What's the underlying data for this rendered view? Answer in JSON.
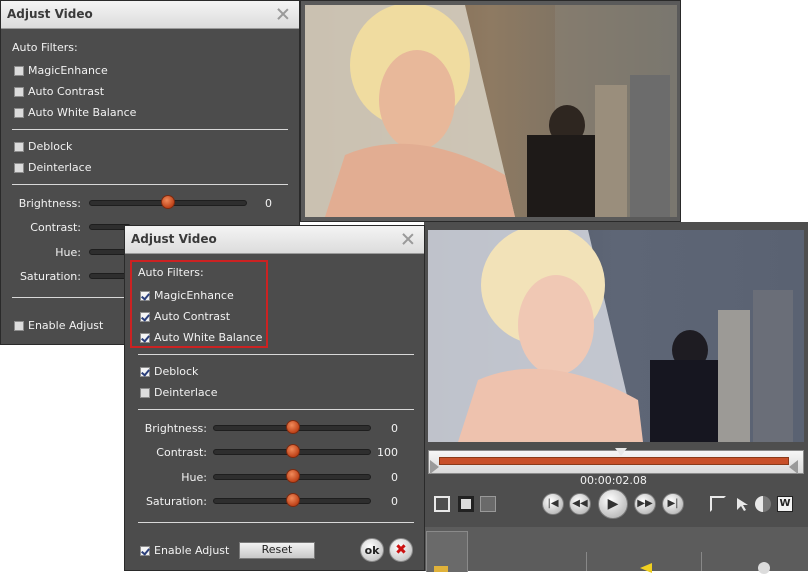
{
  "back_dialog": {
    "title": "Adjust Video",
    "auto_filters_label": "Auto Filters:",
    "filters": [
      {
        "label": "MagicEnhance",
        "checked": false
      },
      {
        "label": "Auto Contrast",
        "checked": false
      },
      {
        "label": "Auto White Balance",
        "checked": false
      }
    ],
    "deblock": {
      "label": "Deblock",
      "checked": false
    },
    "deinterlace": {
      "label": "Deinterlace",
      "checked": false
    },
    "sliders": [
      {
        "label": "Brightness:",
        "value": "0"
      },
      {
        "label": "Contrast:",
        "value": ""
      },
      {
        "label": "Hue:",
        "value": ""
      },
      {
        "label": "Saturation:",
        "value": ""
      }
    ],
    "enable_adjust": {
      "label": "Enable Adjust",
      "checked": false
    }
  },
  "front_dialog": {
    "title": "Adjust Video",
    "auto_filters_label": "Auto Filters:",
    "filters": [
      {
        "label": "MagicEnhance",
        "checked": true
      },
      {
        "label": "Auto Contrast",
        "checked": true
      },
      {
        "label": "Auto White Balance",
        "checked": true
      }
    ],
    "deblock": {
      "label": "Deblock",
      "checked": true
    },
    "deinterlace": {
      "label": "Deinterlace",
      "checked": false
    },
    "sliders": [
      {
        "label": "Brightness:",
        "value": "0"
      },
      {
        "label": "Contrast:",
        "value": "100"
      },
      {
        "label": "Hue:",
        "value": "0"
      },
      {
        "label": "Saturation:",
        "value": "0"
      }
    ],
    "enable_adjust": {
      "label": "Enable Adjust",
      "checked": true
    },
    "reset_label": "Reset",
    "ok_label": "ok",
    "cancel_icon": "x-icon",
    "highlight_color": "#cc2222"
  },
  "player": {
    "timecode": "00:00:02.08",
    "progress_color": "#c8502a"
  }
}
